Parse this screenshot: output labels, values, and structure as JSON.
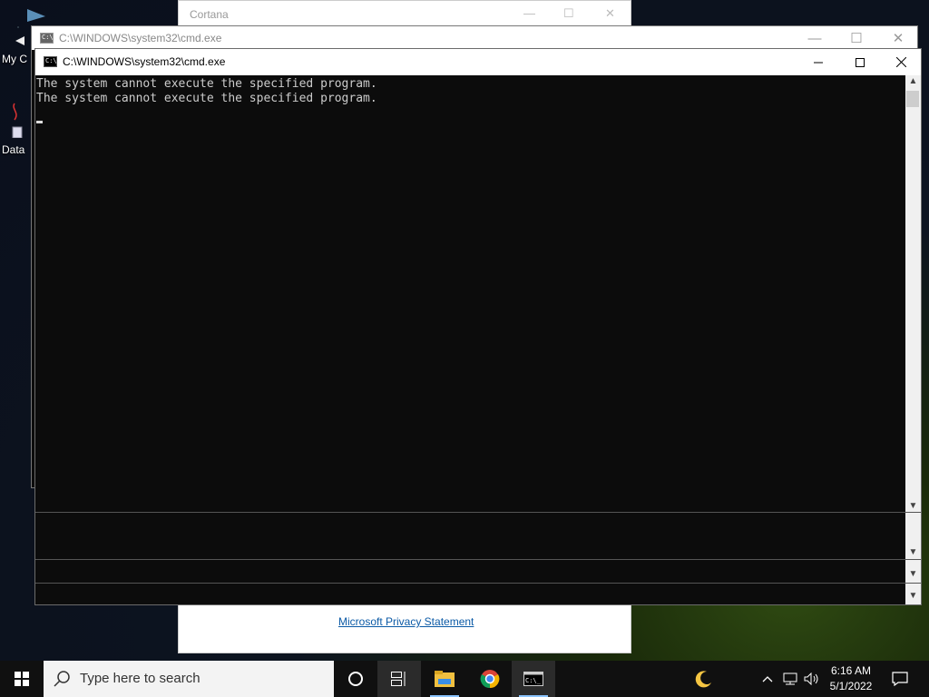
{
  "desktop": {
    "icons": [
      {
        "label": "My C",
        "icon": "computer-icon"
      },
      {
        "label": "Data",
        "icon": "file-icon"
      }
    ]
  },
  "cortana_window": {
    "title": "Cortana",
    "privacy_link": "Microsoft Privacy Statement"
  },
  "cmd_back": {
    "title": "C:\\WINDOWS\\system32\\cmd.exe"
  },
  "cmd_front": {
    "title": "C:\\WINDOWS\\system32\\cmd.exe",
    "icon_text": "C:\\",
    "lines": [
      "The system cannot execute the specified program.",
      "The system cannot execute the specified program."
    ]
  },
  "taskbar": {
    "search_placeholder": "Type here to search",
    "clock_time": "6:16 AM",
    "clock_date": "5/1/2022",
    "apps": [
      "file-explorer-icon",
      "chrome-icon",
      "cmd-icon",
      "night-light-icon"
    ]
  }
}
